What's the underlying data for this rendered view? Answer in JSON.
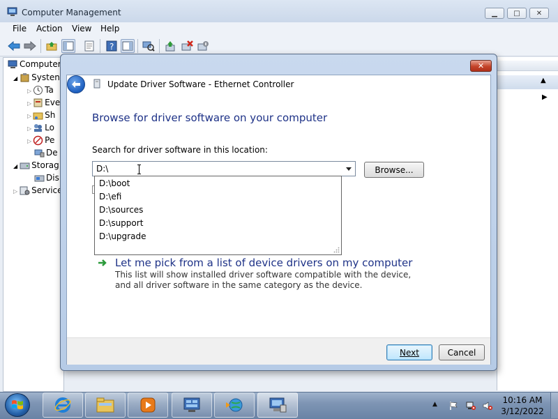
{
  "main_window": {
    "title": "Computer Management",
    "caption_buttons": {
      "minimize": "minimize-icon",
      "maximize": "maximize-icon",
      "close": "close-icon"
    },
    "menu": [
      "File",
      "Action",
      "View",
      "Help"
    ],
    "toolbar_icons": [
      "back-icon",
      "forward-icon",
      "up-folder-icon",
      "show-hide-tree-icon",
      "properties-icon",
      "help-icon",
      "action-pane-icon",
      "scan-hardware-icon",
      "update-driver-icon",
      "uninstall-icon",
      "disable-icon"
    ],
    "tree": {
      "root": "Computer",
      "system": "Systen",
      "items": [
        "Ta",
        "Eve",
        "Sh",
        "Lo",
        "Pe",
        "De"
      ],
      "storage": "Storag",
      "disk": "Dis",
      "services": "Service"
    }
  },
  "dialog": {
    "title": "Update Driver Software - Ethernet Controller",
    "heading": "Browse for driver software on your computer",
    "search_label": "Search for driver software in this location:",
    "path_value": "D:\\",
    "browse_label": "Browse...",
    "dropdown_items": [
      "D:\\boot",
      "D:\\efi",
      "D:\\sources",
      "D:\\support",
      "D:\\upgrade"
    ],
    "pick_option": {
      "title": "Let me pick from a list of device drivers on my computer",
      "description": "This list will show installed driver software compatible with the device, and all driver software in the same category as the device."
    },
    "next_label": "Next",
    "cancel_label": "Cancel"
  },
  "taskbar": {
    "apps": [
      "internet-explorer-icon",
      "windows-explorer-icon",
      "media-player-icon",
      "control-panel-icon",
      "network-icon",
      "computer-management-icon"
    ],
    "clock_time": "10:16 AM",
    "clock_date": "3/12/2022"
  }
}
